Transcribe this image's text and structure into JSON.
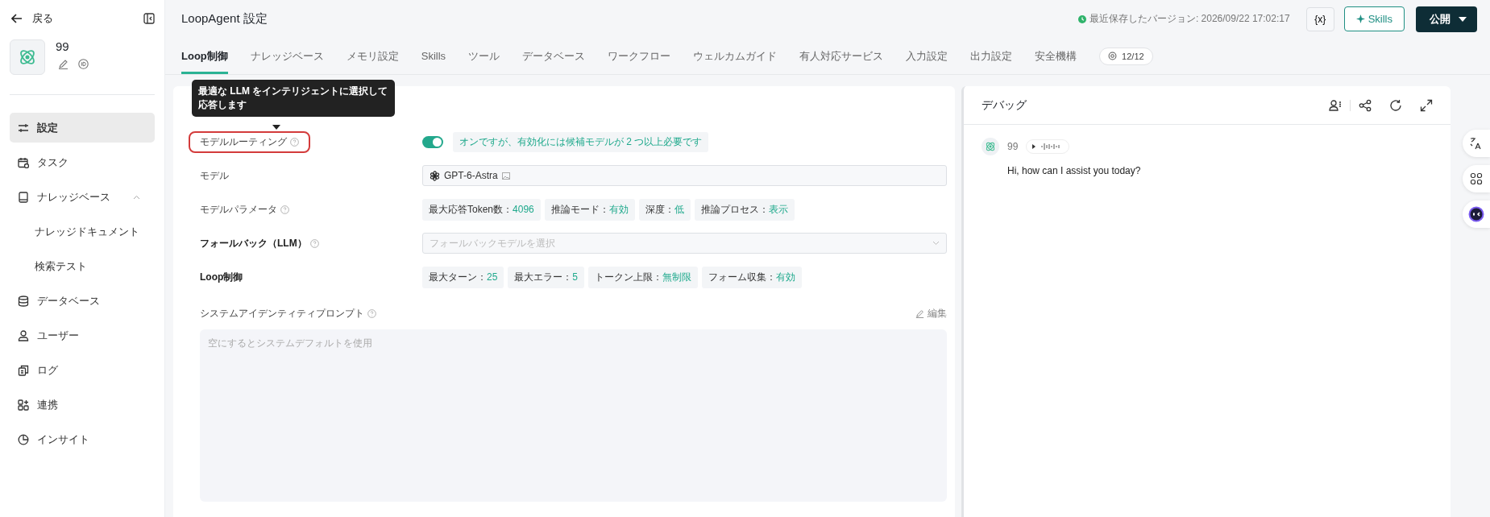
{
  "sidebar": {
    "back": "戻る",
    "agent_name": "99",
    "items": [
      {
        "label": "設定",
        "selected": true
      },
      {
        "label": "タスク",
        "selected": false
      },
      {
        "label": "ナレッジベース",
        "selected": false,
        "expanded": true,
        "children": [
          {
            "label": "ナレッジドキュメント",
            "selected": false
          },
          {
            "label": "検索テスト",
            "selected": false
          }
        ]
      },
      {
        "label": "データベース",
        "selected": false
      },
      {
        "label": "ユーザー",
        "selected": false
      },
      {
        "label": "ログ",
        "selected": false
      },
      {
        "label": "連携",
        "selected": false
      },
      {
        "label": "インサイト",
        "selected": false
      }
    ]
  },
  "header": {
    "title": "LoopAgent 設定",
    "saved": "最近保存したバージョン: 2026/09/22 17:02:17",
    "variables_button": "{x}",
    "skills_button": "Skills",
    "publish_button": "公開"
  },
  "tabs": [
    {
      "label": "Loop制御",
      "selected": true
    },
    {
      "label": "ナレッジベース",
      "selected": false
    },
    {
      "label": "メモリ設定",
      "selected": false
    },
    {
      "label": "Skills",
      "selected": false
    },
    {
      "label": "ツール",
      "selected": false
    },
    {
      "label": "データベース",
      "selected": false
    },
    {
      "label": "ワークフロー",
      "selected": false
    },
    {
      "label": "ウェルカムガイド",
      "selected": false
    },
    {
      "label": "有人対応サービス",
      "selected": false
    },
    {
      "label": "入力設定",
      "selected": false
    },
    {
      "label": "出力設定",
      "selected": false
    },
    {
      "label": "安全機構",
      "selected": false
    }
  ],
  "tab_count": "12/12",
  "tooltip": "最適な LLM をインテリジェントに選択して応答します",
  "settings": [
    {
      "kind": "toggle",
      "label": "モデルルーティング",
      "help": true,
      "bold": false,
      "highlighted": true,
      "on": true,
      "note": "オンですが、有効化には候補モデルが 2 つ以上必要です"
    },
    {
      "kind": "select",
      "label": "モデル",
      "help": false,
      "bold": false,
      "highlighted": false,
      "value": "GPT-6-Astra"
    },
    {
      "kind": "tags",
      "label": "モデルパラメータ",
      "help": true,
      "bold": false,
      "highlighted": false,
      "tags": [
        {
          "label": "最大応答Token数：",
          "value": "4096"
        },
        {
          "label": "推論モード：",
          "value": "有効"
        },
        {
          "label": "深度：",
          "value": "低"
        },
        {
          "label": "推論プロセス：",
          "value": "表示"
        }
      ]
    },
    {
      "kind": "placeholder",
      "label": "フォールバック（LLM）",
      "help": true,
      "bold": true,
      "highlighted": false,
      "placeholder": "フォールバックモデルを選択"
    },
    {
      "kind": "tags",
      "label": "Loop制御",
      "help": false,
      "bold": true,
      "highlighted": false,
      "tags": [
        {
          "label": "最大ターン：",
          "value": "25"
        },
        {
          "label": "最大エラー：",
          "value": "5"
        },
        {
          "label": "トークン上限：",
          "value": "無制限"
        },
        {
          "label": "フォーム収集：",
          "value": "有効"
        }
      ]
    }
  ],
  "prompt": {
    "label": "システムアイデンティティプロンプト",
    "edit": "編集",
    "placeholder": "空にするとシステムデフォルトを使用"
  },
  "debug": {
    "title": "デバッグ",
    "sender": "99",
    "message": "Hi, how can I assist you today?"
  }
}
